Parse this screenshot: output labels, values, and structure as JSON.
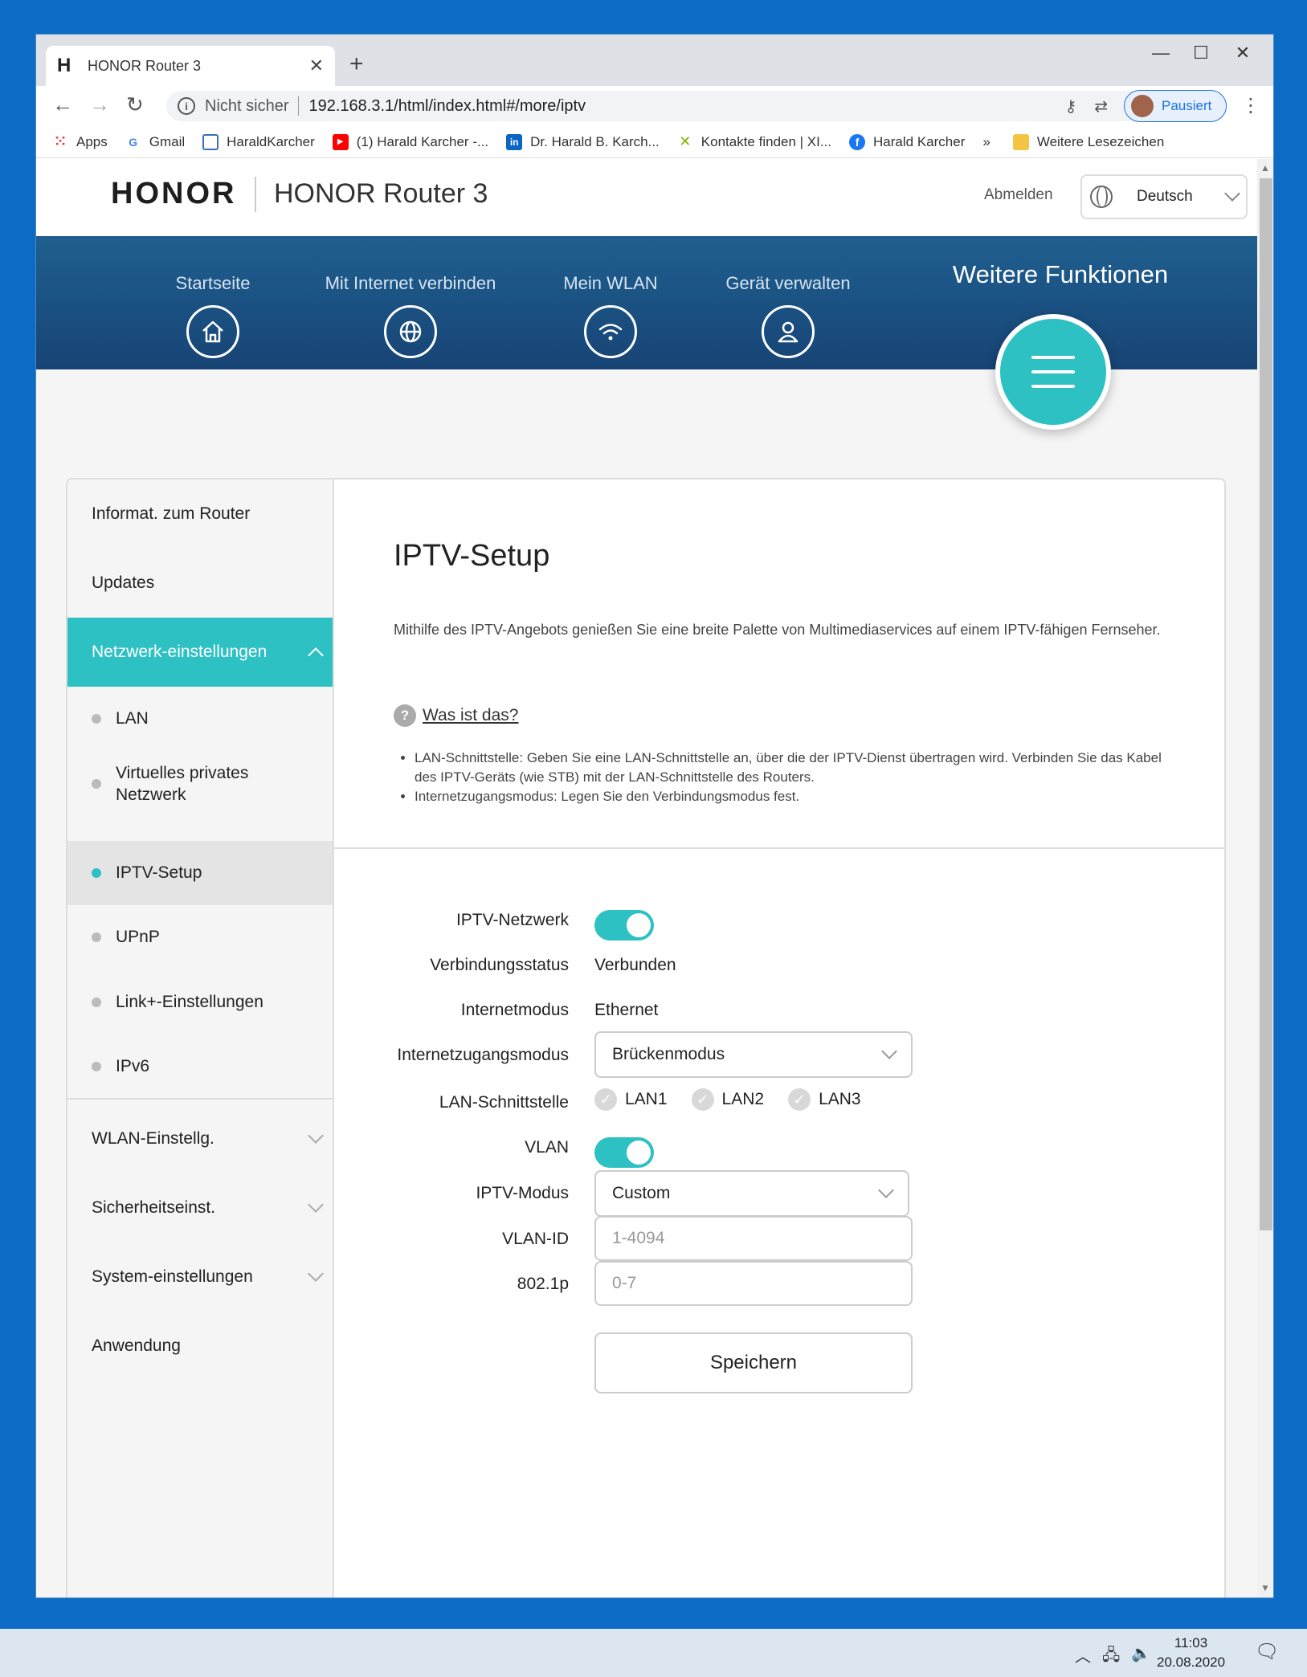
{
  "browser": {
    "tab_favicon": "H",
    "tab_title": "HONOR Router 3",
    "tab_close": "✕",
    "new_tab": "+",
    "win_min": "—",
    "win_max": "☐",
    "win_close": "✕",
    "back": "←",
    "forward": "→",
    "reload": "↻",
    "info_icon": "i",
    "insecure_label": "Nicht sicher",
    "url": "192.168.3.1/html/index.html#/more/iptv",
    "profile_label": "Pausiert",
    "menu": "⋮"
  },
  "bookmarks": [
    {
      "label": "Apps",
      "icon": "apps-grid-icon",
      "color": "#e8453c"
    },
    {
      "label": "Gmail",
      "icon": "google-icon",
      "color": "#4285f4"
    },
    {
      "label": "HaraldKarcher",
      "icon": "page-icon",
      "color": "#3b6fb6"
    },
    {
      "label": "(1) Harald Karcher -...",
      "icon": "youtube-icon",
      "color": "#ff0000"
    },
    {
      "label": "Dr. Harald B. Karch...",
      "icon": "linkedin-icon",
      "color": "#0a66c2"
    },
    {
      "label": "Kontakte finden | XI...",
      "icon": "xing-icon",
      "color": "#7fb800"
    },
    {
      "label": "Harald Karcher",
      "icon": "facebook-icon",
      "color": "#1877f2"
    }
  ],
  "bookmarks_more": "»",
  "bookmarks_other": "Weitere Lesezeichen",
  "header": {
    "logo": "HONOR",
    "product": "HONOR Router 3",
    "logout": "Abmelden",
    "language": "Deutsch"
  },
  "nav": {
    "items": [
      {
        "label": "Startseite",
        "icon": "home-icon"
      },
      {
        "label": "Mit Internet verbinden",
        "icon": "globe-icon"
      },
      {
        "label": "Mein WLAN",
        "icon": "wifi-icon"
      },
      {
        "label": "Gerät verwalten",
        "icon": "user-icon"
      }
    ],
    "active": "Weitere Funktionen",
    "active_icon": "menu-icon"
  },
  "sidebar": {
    "items": [
      {
        "label": "Informat. zum Router"
      },
      {
        "label": "Updates"
      },
      {
        "label": "Netzwerk-einstellungen",
        "expanded": true,
        "active": true
      },
      {
        "label": "WLAN-Einstellg."
      },
      {
        "label": "Sicherheitseinst."
      },
      {
        "label": "System-einstellungen"
      },
      {
        "label": "Anwendung"
      }
    ],
    "subitems": [
      {
        "label": "LAN"
      },
      {
        "label": "Virtuelles privates Netzwerk"
      },
      {
        "label": "IPTV-Setup",
        "active": true
      },
      {
        "label": "UPnP"
      },
      {
        "label": "Link+-Einstellungen"
      },
      {
        "label": "IPv6"
      }
    ]
  },
  "content": {
    "title": "IPTV-Setup",
    "description": "Mithilfe des IPTV-Angebots genießen Sie eine breite Palette von Multimediaservices auf einem IPTV-fähigen Fernseher.",
    "help_icon": "?",
    "help_link": "Was ist das?",
    "bullets": [
      "LAN-Schnittstelle: Geben Sie eine LAN-Schnittstelle an, über die der IPTV-Dienst übertragen wird. Verbinden Sie das Kabel des IPTV-Geräts (wie STB) mit der LAN-Schnittstelle des Routers.",
      "Internetzugangsmodus: Legen Sie den Verbindungsmodus fest."
    ]
  },
  "form": {
    "iptv_network_label": "IPTV-Netzwerk",
    "iptv_network_on": true,
    "status_label": "Verbindungsstatus",
    "status_value": "Verbunden",
    "inet_mode_label": "Internetmodus",
    "inet_mode_value": "Ethernet",
    "access_mode_label": "Internetzugangsmodus",
    "access_mode_value": "Brückenmodus",
    "lan_label": "LAN-Schnittstelle",
    "lan_ports": [
      "LAN1",
      "LAN2",
      "LAN3"
    ],
    "check_mark": "✓",
    "vlan_label": "VLAN",
    "vlan_on": true,
    "iptv_mode_label": "IPTV-Modus",
    "iptv_mode_value": "Custom",
    "vlan_id_label": "VLAN-ID",
    "vlan_id_placeholder": "1-4094",
    "dot1p_label": "802.1p",
    "dot1p_placeholder": "0-7",
    "save_label": "Speichern"
  },
  "taskbar": {
    "chevron": "︿",
    "time": "11:03",
    "date": "20.08.2020"
  }
}
